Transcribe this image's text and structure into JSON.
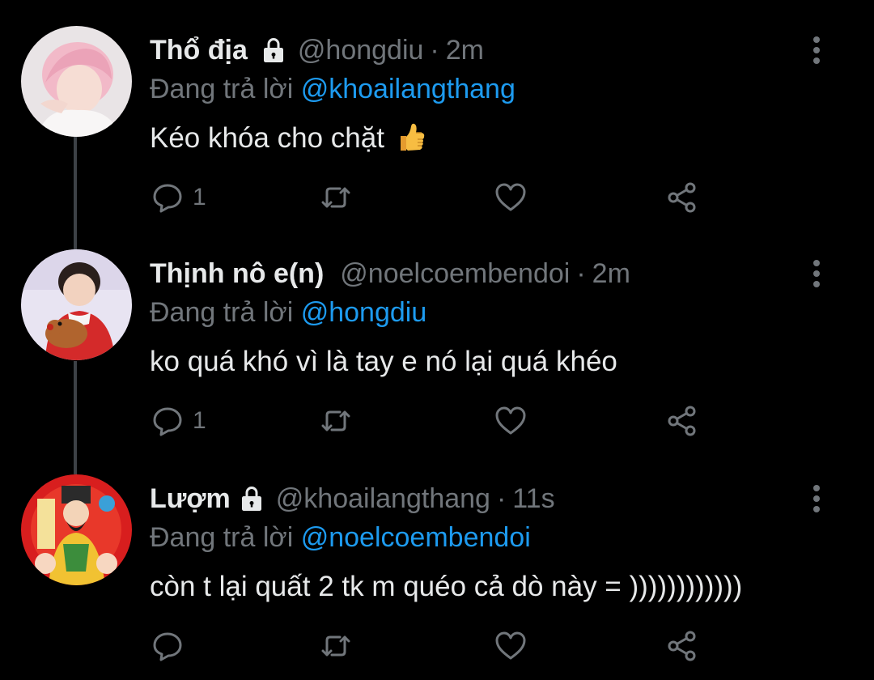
{
  "tweets": [
    {
      "name": "Thổ địa",
      "locked": true,
      "handle": "@hongdiu",
      "dot": "·",
      "time": "2m",
      "reply_label": "Đang trả lời",
      "reply_to": "@khoailangthang",
      "text": "Kéo khóa cho chặt",
      "emoji": "thumbs-up-icon",
      "reply_count": "1"
    },
    {
      "name": "Thịnh nô e(n)",
      "locked": false,
      "handle": "@noelcoembendoi",
      "dot": "·",
      "time": "2m",
      "reply_label": "Đang trả lời",
      "reply_to": "@hongdiu",
      "text": "ko quá khó vì là tay e nó lại quá khéo",
      "reply_count": "1"
    },
    {
      "name": "Lượm",
      "locked": true,
      "handle": "@khoailangthang",
      "dot": "·",
      "time": "11s",
      "reply_label": "Đang trả lời",
      "reply_to": "@noelcoembendoi",
      "text": "còn t lại quất 2 tk m quéo cả dò này = ))))))))))))",
      "reply_count": ""
    }
  ],
  "colors": {
    "background": "#000000",
    "text": "#e7e9ea",
    "secondary": "#71767b",
    "mention": "#1d9bf0",
    "thread_line": "#3d4146"
  }
}
